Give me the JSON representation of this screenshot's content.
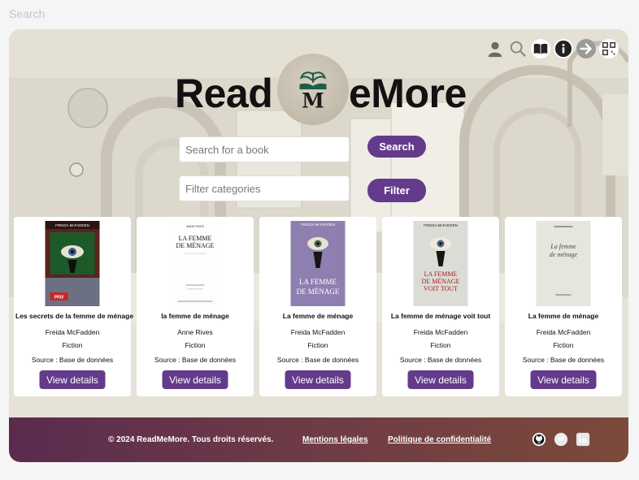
{
  "top_search": {
    "label": "Search"
  },
  "brand": {
    "part1": "Read",
    "part2": "eMore",
    "logo_letter": "M"
  },
  "header_icons": [
    "user-icon",
    "search-icon",
    "book-icon",
    "info-icon",
    "arrow-right-icon",
    "qr-code-icon"
  ],
  "search": {
    "placeholder": "Search for a book",
    "button": "Search"
  },
  "filter": {
    "placeholder": "Filter categories",
    "button": "Filter"
  },
  "books": [
    {
      "title": "Les secrets de la femme de ménage",
      "author": "Freida McFadden",
      "genre": "Fiction",
      "source": "Source : Base de données",
      "button": "View details",
      "cover": {
        "top_text": "FREIDA McFADDEN",
        "badge": "PRIX"
      }
    },
    {
      "title": "la femme de ménage",
      "author": "Anne Rives",
      "genre": "Fiction",
      "source": "Source : Base de données",
      "button": "View details",
      "cover": {
        "top_text": "ANNE RIVES",
        "title": "LA FEMME DE MÉNAGE"
      }
    },
    {
      "title": "La femme de ménage",
      "author": "Freida McFadden",
      "genre": "Fiction",
      "source": "Source : Base de données",
      "button": "View details",
      "cover": {
        "top_text": "FREIDA McFADDEN",
        "title": "LA FEMME DE MÉNAGE"
      }
    },
    {
      "title": "La femme de ménage voit tout",
      "author": "Freida McFadden",
      "genre": "Fiction",
      "source": "Source : Base de données",
      "button": "View details",
      "cover": {
        "top_text": "FREIDA McFADDEN",
        "title": "LA FEMME DE MÉNAGE VOIT TOUT"
      }
    },
    {
      "title": "La femme de ménage",
      "author": "Freida McFadden",
      "genre": "Fiction",
      "source": "Source : Base de données",
      "button": "View details",
      "cover": {
        "title": "La femme de ménage"
      }
    }
  ],
  "footer": {
    "copyright": "© 2024 ReadMeMore. Tous droits réservés.",
    "links": [
      "Mentions légales",
      "Politique de confidentialité"
    ],
    "social": [
      "github-icon",
      "twitter-icon",
      "linkedin-icon"
    ]
  },
  "colors": {
    "accent": "#643b8b",
    "footer_start": "#5b2b4f",
    "footer_end": "#7b4a3a"
  }
}
